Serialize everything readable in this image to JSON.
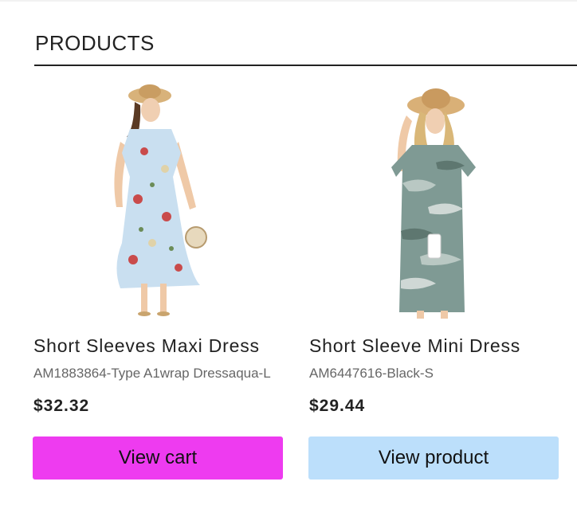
{
  "section": {
    "title": "PRODUCTS"
  },
  "products": [
    {
      "name": "Short Sleeves Maxi Dress",
      "sku": "AM1883864-Type A1wrap Dressaqua-L",
      "price": "$32.32",
      "button_label": "View cart",
      "image_icon": "floral-maxi-dress-image",
      "dress_color": "#c9dff0",
      "button_color": "#ee3bf0"
    },
    {
      "name": "Short Sleeve Mini Dress",
      "sku": "AM6447616-Black-S",
      "price": "$29.44",
      "button_label": "View product",
      "image_icon": "camo-mini-dress-image",
      "dress_color": "#7f9a94",
      "button_color": "#bcdffb"
    }
  ]
}
